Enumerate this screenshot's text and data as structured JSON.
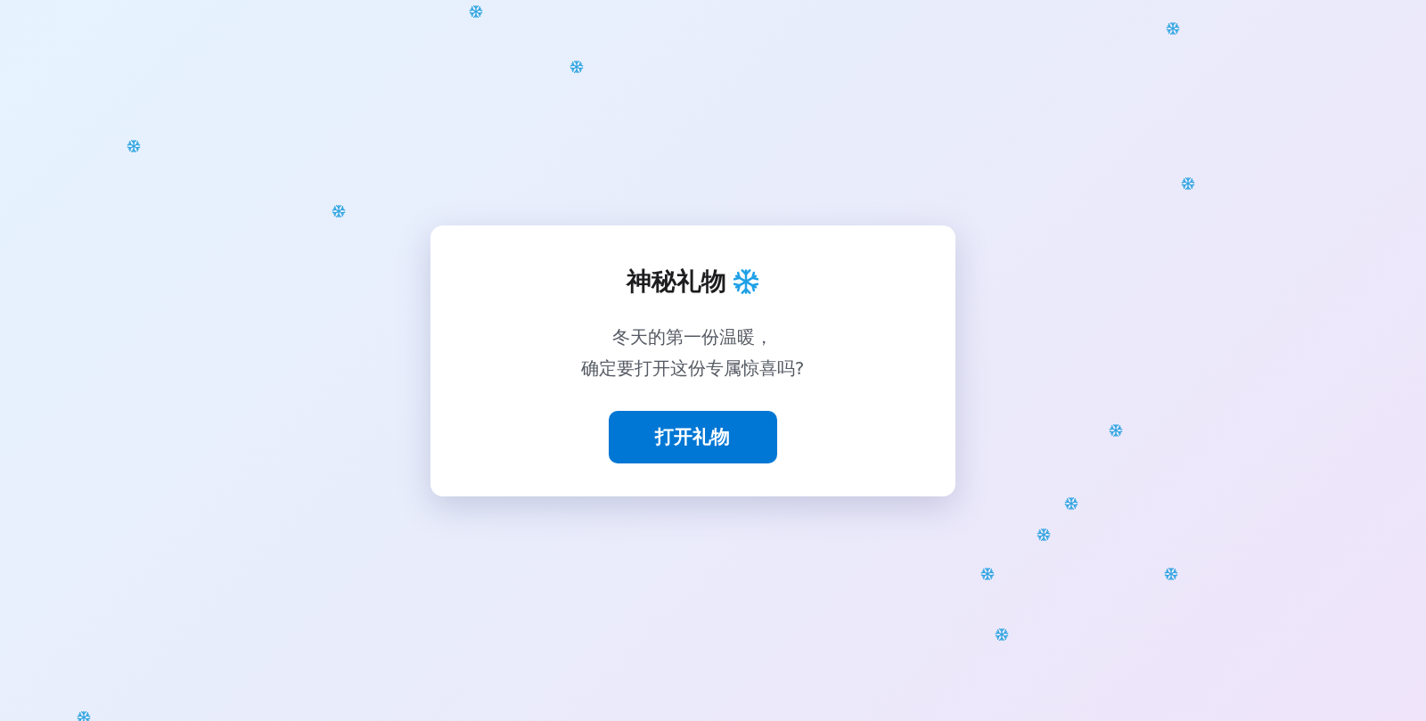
{
  "dialog": {
    "title": "神秘礼物",
    "message_lines": [
      "冬天的第一份温暖，",
      "确定要打开这份专属惊喜吗?"
    ],
    "button": {
      "label": "打开礼物"
    }
  }
}
